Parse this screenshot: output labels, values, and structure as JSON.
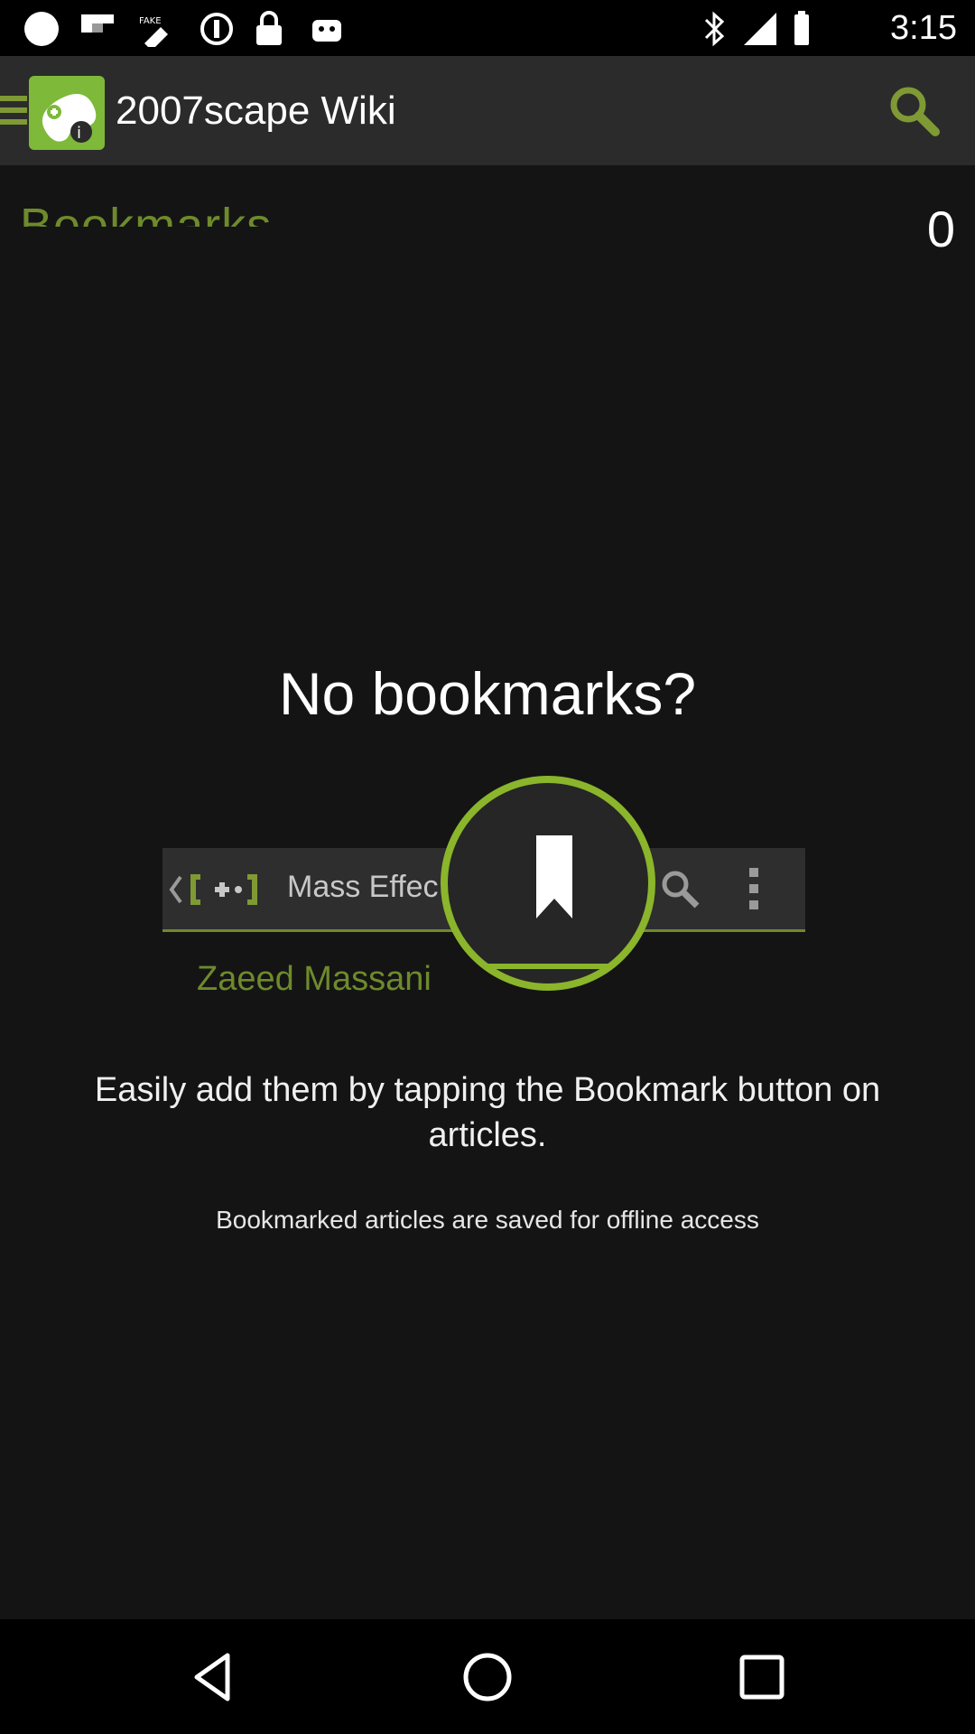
{
  "status_bar": {
    "time": "3:15",
    "icons": [
      "notification-dot-icon",
      "flipboard-icon",
      "fake-gps-icon",
      "data-saver-icon",
      "lock-icon",
      "android-icon",
      "bluetooth-icon",
      "signal-icon",
      "battery-icon"
    ]
  },
  "app_bar": {
    "title": "2007scape Wiki",
    "menu_icon": "hamburger-menu-icon",
    "logo_icon": "gamepad-info-icon",
    "search_icon": "search-icon",
    "accent": "#7f9a34"
  },
  "bookmarks": {
    "label": "Bookmarks",
    "count": "0"
  },
  "empty_state": {
    "title": "No bookmarks?",
    "illustration": {
      "bar_text": "Mass Effec",
      "sub_text": "Zaeed Massani",
      "icon": "bookmark-icon"
    },
    "description": "Easily add them by tapping the Bookmark button on articles.",
    "note": "Bookmarked articles are saved for offline access"
  },
  "nav_bar": {
    "back": "back-triangle-icon",
    "home": "home-circle-icon",
    "recents": "recents-square-icon"
  }
}
